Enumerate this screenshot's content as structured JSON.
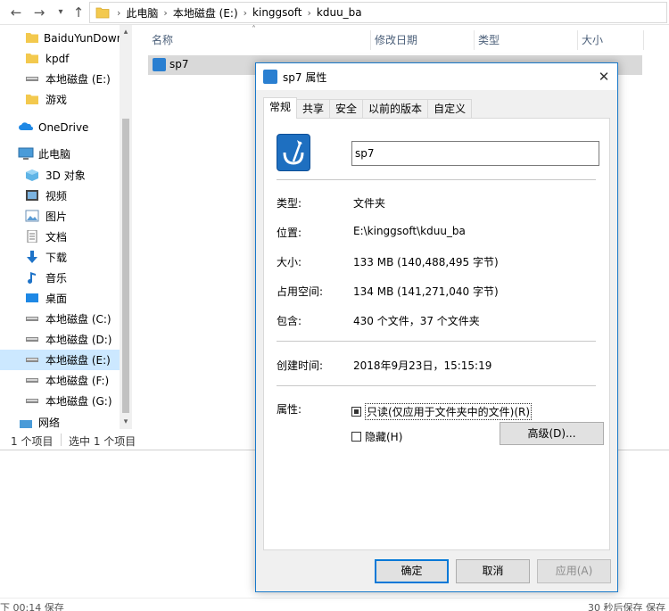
{
  "address_bar": {
    "crumbs": [
      "此电脑",
      "本地磁盘 (E:)",
      "kinggsoft",
      "kduu_ba"
    ]
  },
  "sidebar": {
    "items": [
      {
        "label": "BaiduYunDown",
        "icon": "folder-icon"
      },
      {
        "label": "kpdf",
        "icon": "folder-icon"
      },
      {
        "label": "本地磁盘 (E:)",
        "icon": "drive-icon"
      },
      {
        "label": "游戏",
        "icon": "folder-icon"
      },
      {
        "label": "OneDrive",
        "icon": "cloud-icon"
      },
      {
        "label": "此电脑",
        "icon": "computer-icon"
      },
      {
        "label": "3D 对象",
        "icon": "3d-objects-icon"
      },
      {
        "label": "视频",
        "icon": "video-icon"
      },
      {
        "label": "图片",
        "icon": "pictures-icon"
      },
      {
        "label": "文档",
        "icon": "documents-icon"
      },
      {
        "label": "下载",
        "icon": "download-icon"
      },
      {
        "label": "音乐",
        "icon": "music-icon"
      },
      {
        "label": "桌面",
        "icon": "desktop-icon"
      },
      {
        "label": "本地磁盘 (C:)",
        "icon": "drive-icon"
      },
      {
        "label": "本地磁盘 (D:)",
        "icon": "drive-icon"
      },
      {
        "label": "本地磁盘 (E:)",
        "icon": "drive-icon",
        "selected": true
      },
      {
        "label": "本地磁盘 (F:)",
        "icon": "drive-icon"
      },
      {
        "label": "本地磁盘 (G:)",
        "icon": "drive-icon"
      },
      {
        "label": "网络",
        "icon": "network-icon"
      }
    ]
  },
  "file_list": {
    "columns": [
      "名称",
      "修改日期",
      "类型",
      "大小"
    ],
    "rows": [
      {
        "name": "sp7"
      }
    ]
  },
  "status_bar": {
    "item_count": "1 个项目",
    "selected_count": "选中 1 个项目"
  },
  "bottom_strip": {
    "left": "下 00:14 保存",
    "right": "30 秒后保存 保存"
  },
  "dialog": {
    "title": "sp7 属性",
    "tabs": [
      "常规",
      "共享",
      "安全",
      "以前的版本",
      "自定义"
    ],
    "active_tab": 0,
    "name_value": "sp7",
    "props": {
      "type_label": "类型:",
      "type_value": "文件夹",
      "location_label": "位置:",
      "location_value": "E:\\kinggsoft\\kduu_ba",
      "size_label": "大小:",
      "size_value": "133 MB (140,488,495 字节)",
      "disk_size_label": "占用空间:",
      "disk_size_value": "134 MB (141,271,040 字节)",
      "contains_label": "包含:",
      "contains_value": "430 个文件，37 个文件夹",
      "created_label": "创建时间:",
      "created_value": "2018年9月23日，15:15:19",
      "attributes_label": "属性:"
    },
    "readonly_label": "只读(仅应用于文件夹中的文件)(R)",
    "hidden_label": "隐藏(H)",
    "advanced_button": "高级(D)...",
    "ok_button": "确定",
    "cancel_button": "取消",
    "apply_button": "应用(A)"
  },
  "colors": {
    "accent": "#0078d7",
    "selection": "#cce8ff",
    "dialog_border": "#1979ca"
  }
}
